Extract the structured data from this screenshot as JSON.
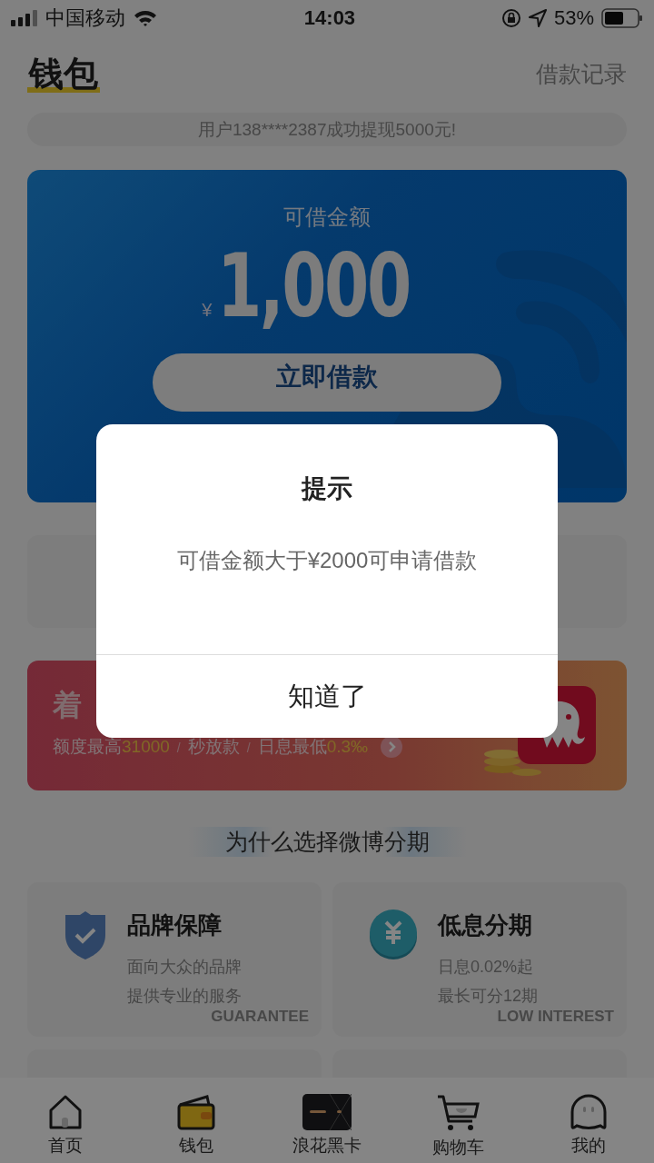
{
  "status_bar": {
    "carrier": "中国移动",
    "time": "14:03",
    "battery": "53%"
  },
  "header": {
    "title": "钱包",
    "link": "借款记录"
  },
  "ticker": "用户138****2387成功提现5000元!",
  "loan_card": {
    "label": "可借金额",
    "currency": "¥",
    "amount": "1,000",
    "button": "立即借款"
  },
  "promo_banner": {
    "title": "着",
    "details": [
      {
        "kind": "plain",
        "text": "额度最高"
      },
      {
        "kind": "highlight",
        "text": "31000"
      },
      {
        "kind": "separator",
        "text": "/"
      },
      {
        "kind": "plain",
        "text": "秒放款"
      },
      {
        "kind": "separator",
        "text": "/"
      },
      {
        "kind": "plain",
        "text": "日息最低"
      },
      {
        "kind": "highlight",
        "text": "0.3‰"
      }
    ]
  },
  "section_title": "为什么选择微博分期",
  "features": [
    {
      "kind": "shield",
      "title": "品牌保障",
      "watermark": "GUARANTEE",
      "lines": [
        "面向大众的品牌",
        "提供专业的服务"
      ]
    },
    {
      "kind": "yen",
      "title": "低息分期",
      "watermark": "LOW INTEREST",
      "lines": [
        "日息0.02%起",
        "最长可分12期"
      ]
    }
  ],
  "tab_bar": [
    {
      "kind": "home",
      "label": "首页",
      "selected": false
    },
    {
      "kind": "wallet",
      "label": "钱包",
      "selected": true
    },
    {
      "kind": "card",
      "label": "浪花黑卡",
      "selected": false
    },
    {
      "kind": "cart",
      "label": "购物车",
      "selected": false
    },
    {
      "kind": "profile",
      "label": "我的",
      "selected": false
    }
  ],
  "dialog": {
    "title": "提示",
    "message": "可借金额大于¥2000可申请借款",
    "button": "知道了"
  }
}
